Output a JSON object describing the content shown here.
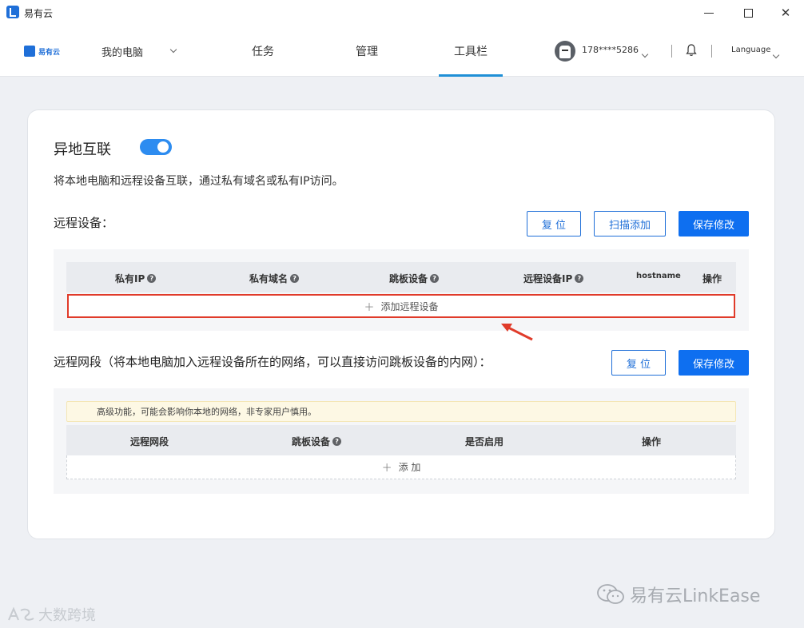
{
  "app": {
    "title": "易有云"
  },
  "nav": {
    "logo_text": "易有云",
    "my_pc": "我的电脑",
    "tasks": "任务",
    "manage": "管理",
    "toolbar": "工具栏",
    "phone": "178****5286",
    "language": "Language"
  },
  "main": {
    "title": "异地互联",
    "toggle_on": true,
    "description": "将本地电脑和远程设备互联，通过私有域名或私有IP访问。",
    "remote_devices": {
      "title": "远程设备：",
      "reset": "复 位",
      "scan_add": "扫描添加",
      "save": "保存修改",
      "columns": [
        "私有IP",
        "私有域名",
        "跳板设备",
        "远程设备IP",
        "hostname",
        "操作"
      ],
      "add_label": "添加远程设备"
    },
    "remote_segments": {
      "title": "远程网段（将本地电脑加入远程设备所在的网络，可以直接访问跳板设备的内网）：",
      "reset": "复 位",
      "save": "保存修改",
      "warning": "高级功能，可能会影响你本地的网络，非专家用户慎用。",
      "columns": [
        "远程网段",
        "跳板设备",
        "是否启用",
        "操作"
      ],
      "add_label": "添 加"
    }
  },
  "watermarks": {
    "wechat": "易有云LinkEase",
    "corner": "大数跨境"
  },
  "colors": {
    "accent": "#1f6fd8",
    "primary_button": "#0e6ff0",
    "highlight_border": "#e03b2a",
    "toggle": "#2d8cf0"
  }
}
